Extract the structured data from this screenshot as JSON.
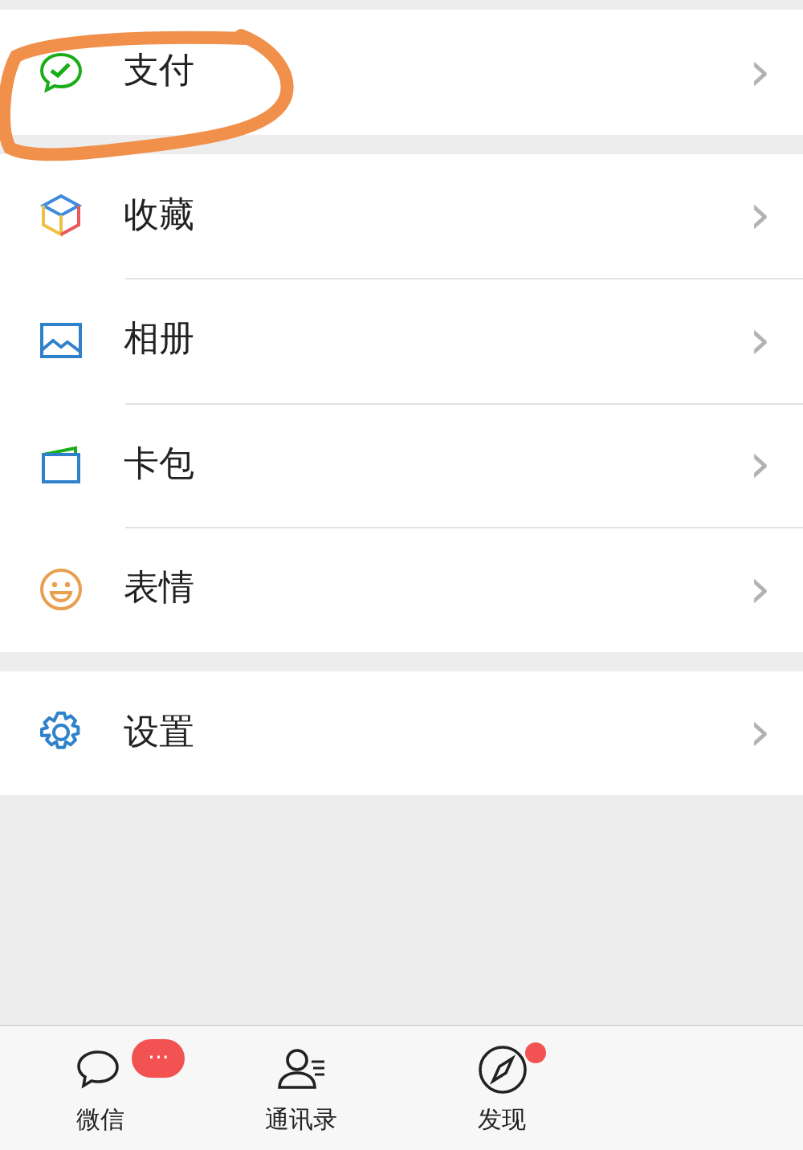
{
  "groups": [
    {
      "items": [
        {
          "kind": "pay",
          "label": "支付",
          "chevron": "›"
        }
      ]
    },
    {
      "items": [
        {
          "kind": "favorites",
          "label": "收藏",
          "chevron": "›"
        },
        {
          "kind": "album",
          "label": "相册",
          "chevron": "›"
        },
        {
          "kind": "cards",
          "label": "卡包",
          "chevron": "›"
        },
        {
          "kind": "stickers",
          "label": "表情",
          "chevron": "›"
        }
      ]
    },
    {
      "items": [
        {
          "kind": "settings",
          "label": "设置",
          "chevron": "›"
        }
      ]
    }
  ],
  "tab_bar": [
    {
      "kind": "chats",
      "label": "微信",
      "badge": "···",
      "dot": false
    },
    {
      "kind": "contacts",
      "label": "通讯录",
      "dot": false
    },
    {
      "kind": "discover",
      "label": "发现",
      "dot": true
    }
  ]
}
